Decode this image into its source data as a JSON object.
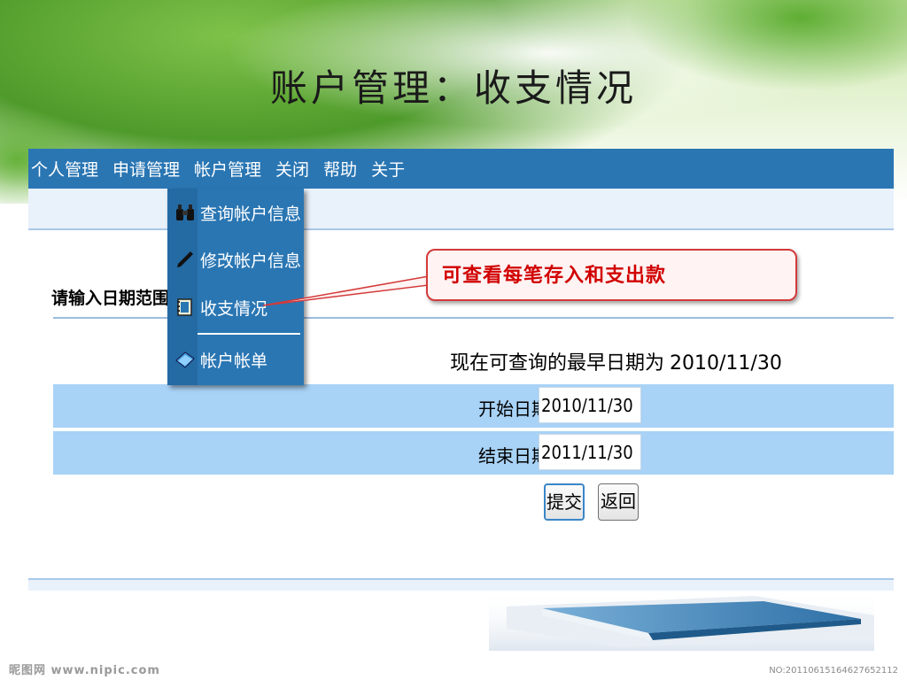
{
  "slide": {
    "title": "账户管理：收支情况"
  },
  "menubar": {
    "items": [
      "个人管理",
      "申请管理",
      "帐户管理",
      "关闭",
      "帮助",
      "关于"
    ]
  },
  "dropdown": {
    "items": [
      {
        "label": "查询帐户信息",
        "icon": "binoculars-icon"
      },
      {
        "label": "修改帐户信息",
        "icon": "pen-icon"
      },
      {
        "label": "收支情况",
        "icon": "ledger-icon"
      },
      {
        "label": "帐户帐单",
        "icon": "book-icon"
      }
    ]
  },
  "form": {
    "range_label": "请输入日期范围",
    "earliest_text": "现在可查询的最早日期为",
    "earliest_date": "2010/11/30",
    "start_label": "开始日期",
    "start_value": "2010/11/30",
    "end_label": "结束日期",
    "end_value": "2011/11/30",
    "submit_label": "提交",
    "back_label": "返回"
  },
  "callout": {
    "text": "可查看每笔存入和支出款"
  },
  "watermark": {
    "left": "昵图网 www.nipic.com",
    "right": "NO:20110615164627652112"
  },
  "colors": {
    "menubar": "#2a76b3",
    "row": "#a8d2f6",
    "callout_border": "#d43a3a",
    "callout_text": "#d10000"
  }
}
